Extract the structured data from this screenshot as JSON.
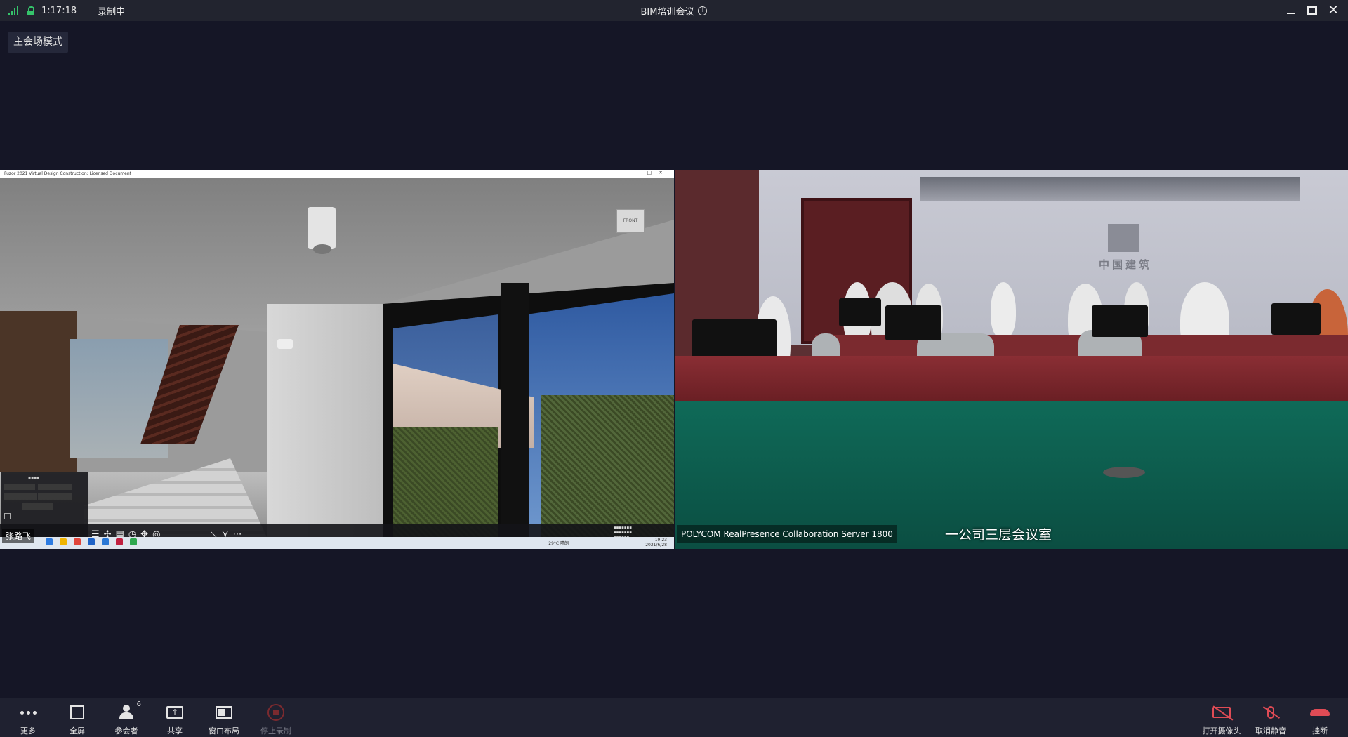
{
  "titlebar": {
    "duration": "1:17:18",
    "recording_status": "录制中",
    "meeting_title": "BIM培训会议",
    "info_glyph": "i"
  },
  "mode_badge": "主会场模式",
  "left_video": {
    "app_title": "Fuzor 2021 Virtual Design Construction: Licensed Document",
    "participant_name": "张路飞",
    "taskbar_weather": "29°C 晴朗",
    "taskbar_time": "19:23",
    "taskbar_date": "2021/6/28"
  },
  "right_video": {
    "logo_text": "中国建筑",
    "server_label": "POLYCOM RealPresence Collaboration Server 1800",
    "room_label": "一公司三层会议室"
  },
  "bottombar": {
    "more": "更多",
    "fullscreen": "全屏",
    "participants": "参会者",
    "participants_count": "6",
    "share": "共享",
    "share_glyph": "↑",
    "window_layout": "窗口布局",
    "stop_recording": "停止录制",
    "open_camera": "打开摄像头",
    "unmute": "取消静音",
    "hang_up": "挂断"
  },
  "colors": {
    "background": "#151626",
    "titlebar": "#22242f",
    "bottombar": "#1f2130",
    "signal_green": "#35c46b",
    "danger_red": "#e04b55"
  },
  "icons": {
    "signal": "signal-bars-icon",
    "lock": "lock-icon",
    "info": "info-icon",
    "more": "more-dots-icon",
    "fullscreen": "fullscreen-icon",
    "participants": "participants-icon",
    "share": "share-screen-icon",
    "layout": "window-layout-icon",
    "stop_recording": "stop-recording-icon",
    "camera_off": "camera-off-icon",
    "mic_off": "mic-muted-icon",
    "hang_up": "hang-up-icon"
  }
}
